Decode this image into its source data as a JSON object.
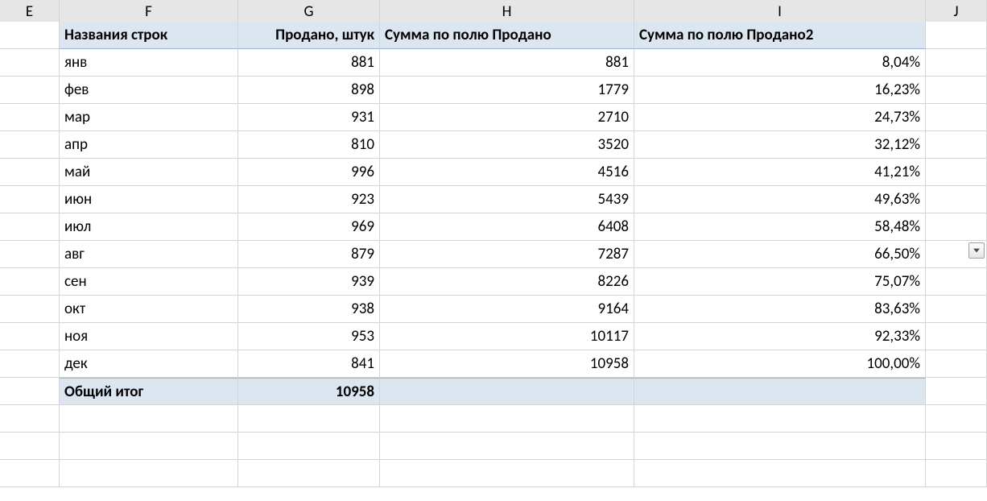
{
  "columns": [
    "E",
    "F",
    "G",
    "H",
    "I",
    "J"
  ],
  "pivot": {
    "headers": {
      "row_labels": "Названия строк",
      "sold_qty": "Продано, штук",
      "sum_sold": "Сумма по полю Продано",
      "sum_sold2": "Сумма по полю Продано2"
    },
    "rows": [
      {
        "label": "янв",
        "qty": "881",
        "sum": "881",
        "pct": "8,04%"
      },
      {
        "label": "фев",
        "qty": "898",
        "sum": "1779",
        "pct": "16,23%"
      },
      {
        "label": "мар",
        "qty": "931",
        "sum": "2710",
        "pct": "24,73%"
      },
      {
        "label": "апр",
        "qty": "810",
        "sum": "3520",
        "pct": "32,12%"
      },
      {
        "label": "май",
        "qty": "996",
        "sum": "4516",
        "pct": "41,21%"
      },
      {
        "label": "июн",
        "qty": "923",
        "sum": "5439",
        "pct": "49,63%"
      },
      {
        "label": "июл",
        "qty": "969",
        "sum": "6408",
        "pct": "58,48%"
      },
      {
        "label": "авг",
        "qty": "879",
        "sum": "7287",
        "pct": "66,50%"
      },
      {
        "label": "сен",
        "qty": "939",
        "sum": "8226",
        "pct": "75,07%"
      },
      {
        "label": "окт",
        "qty": "938",
        "sum": "9164",
        "pct": "83,63%"
      },
      {
        "label": "ноя",
        "qty": "953",
        "sum": "10117",
        "pct": "92,33%"
      },
      {
        "label": "дек",
        "qty": "841",
        "sum": "10958",
        "pct": "100,00%"
      }
    ],
    "grand_total": {
      "label": "Общий итог",
      "qty": "10958",
      "sum": "",
      "pct": ""
    }
  }
}
